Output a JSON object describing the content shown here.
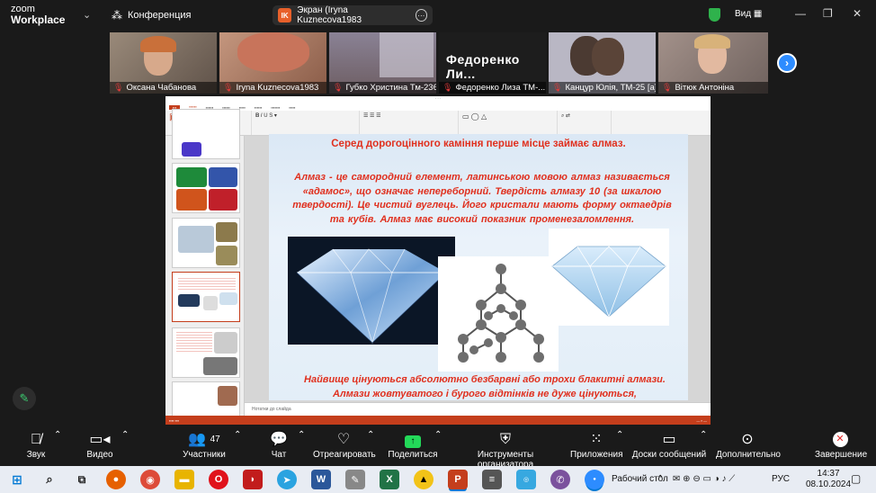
{
  "app": {
    "logo_top": "zoom",
    "logo_bottom": "Workplace",
    "meeting": "Конференция"
  },
  "share_pill": {
    "badge": "IK",
    "text": "Экран (Iryna Kuznecova1983"
  },
  "view_label": "Вид",
  "participants_strip": [
    {
      "name": "Оксана Чабанова",
      "bg": "#7b6a5c"
    },
    {
      "name": "Iryna Kuznecova1983",
      "bg": "#b98a72",
      "active": true
    },
    {
      "name": "Губко Христина Тм-236",
      "bg": "#7a6777"
    },
    {
      "name": "Федоренко Лиза ТМ-...",
      "big": "Федоренко  Ли...",
      "bg": "#222222"
    },
    {
      "name": "Канцур Юлія, ТМ-25 [а]",
      "bg": "#b7b5c2"
    },
    {
      "name": "Вітюк Антоніна",
      "bg": "#8f7e78"
    }
  ],
  "slide": {
    "heading": "Серед дорогоцінного каміння перше місце займає алмаз.",
    "body": "Алмаз - це самородний елемент, латинською мовою алмаз називається «адамос», що означає непереборний. Твердість алмазу 10 (за шкалою твердості). Це чистий вуглець. Його кристали мають форму октаедрів та кубів. Алмаз має високий показник променезаломлення.",
    "bottom": "Найвище цінуються абсолютно безбарвні або трохи блакитні алмази. Алмази жовтуватого і бурого відтінків не дуже цінуються,",
    "notes": "Нотатки до слайда"
  },
  "toolbar": {
    "audio": "Звук",
    "video": "Видео",
    "participants": "Участники",
    "participants_count": "47",
    "chat": "Чат",
    "react": "Отреагировать",
    "share": "Поделиться",
    "host_tools": "Инструменты организатора",
    "apps": "Приложения",
    "whiteboards": "Доски сообщений",
    "more": "Дополнительно",
    "end": "Завершение"
  },
  "taskbar": {
    "desktop": "Рабочий стол",
    "lang": "РУС",
    "time": "14:37",
    "date": "08.10.2024"
  },
  "colors": {
    "accent": "#2d8cff",
    "slide_text": "#e0301e",
    "ppt": "#c43e1c",
    "active_tile": "#23d959"
  }
}
